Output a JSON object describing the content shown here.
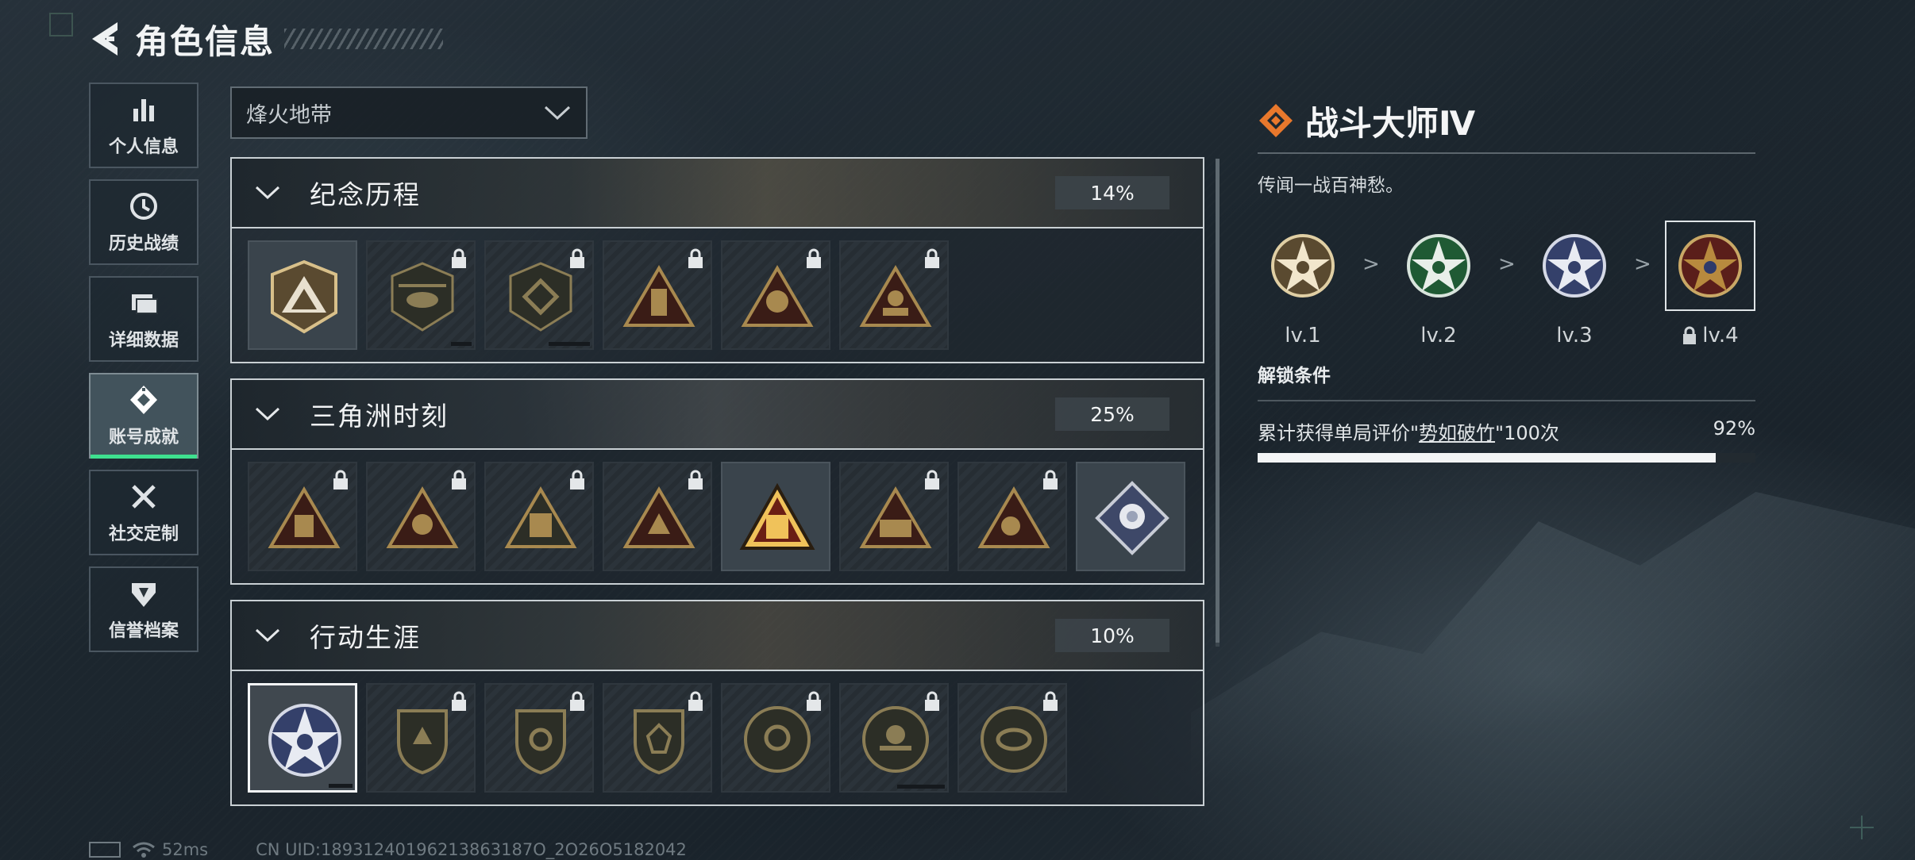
{
  "header": {
    "title": "角色信息"
  },
  "sidebar": {
    "items": [
      {
        "label": "个人信息",
        "icon": "bar-chart-icon",
        "active": false
      },
      {
        "label": "历史战绩",
        "icon": "history-icon",
        "active": false
      },
      {
        "label": "详细数据",
        "icon": "folder-icon",
        "active": false
      },
      {
        "label": "账号成就",
        "icon": "achievement-icon",
        "active": true
      },
      {
        "label": "社交定制",
        "icon": "tools-icon",
        "active": false
      },
      {
        "label": "信誉档案",
        "icon": "shield-icon",
        "active": false
      }
    ]
  },
  "filter": {
    "selected": "烽火地带"
  },
  "categories": [
    {
      "title": "纪念历程",
      "percent": "14%"
    },
    {
      "title": "三角洲时刻",
      "percent": "25%"
    },
    {
      "title": "行动生涯",
      "percent": "10%"
    }
  ],
  "detail": {
    "title": "战斗大师Ⅳ",
    "description": "传闻一战百神愁。",
    "levels": [
      "lv.1",
      "lv.2",
      "lv.3",
      "lv.4"
    ],
    "arrow": ">",
    "unlock_title": "解锁条件",
    "condition_prefix": "累计获得单局评价\"",
    "condition_highlight": "势如破竹",
    "condition_suffix": "\"100次",
    "condition_percent": "92%",
    "condition_progress": 0.92
  },
  "footer": {
    "ping": "52ms",
    "uid": "CN UID:18931240196213863187O_2O26O5182042"
  },
  "colors": {
    "accent_green": "#3ee08f",
    "brand_orange": "#e8782c",
    "gold": "#c9a866"
  }
}
